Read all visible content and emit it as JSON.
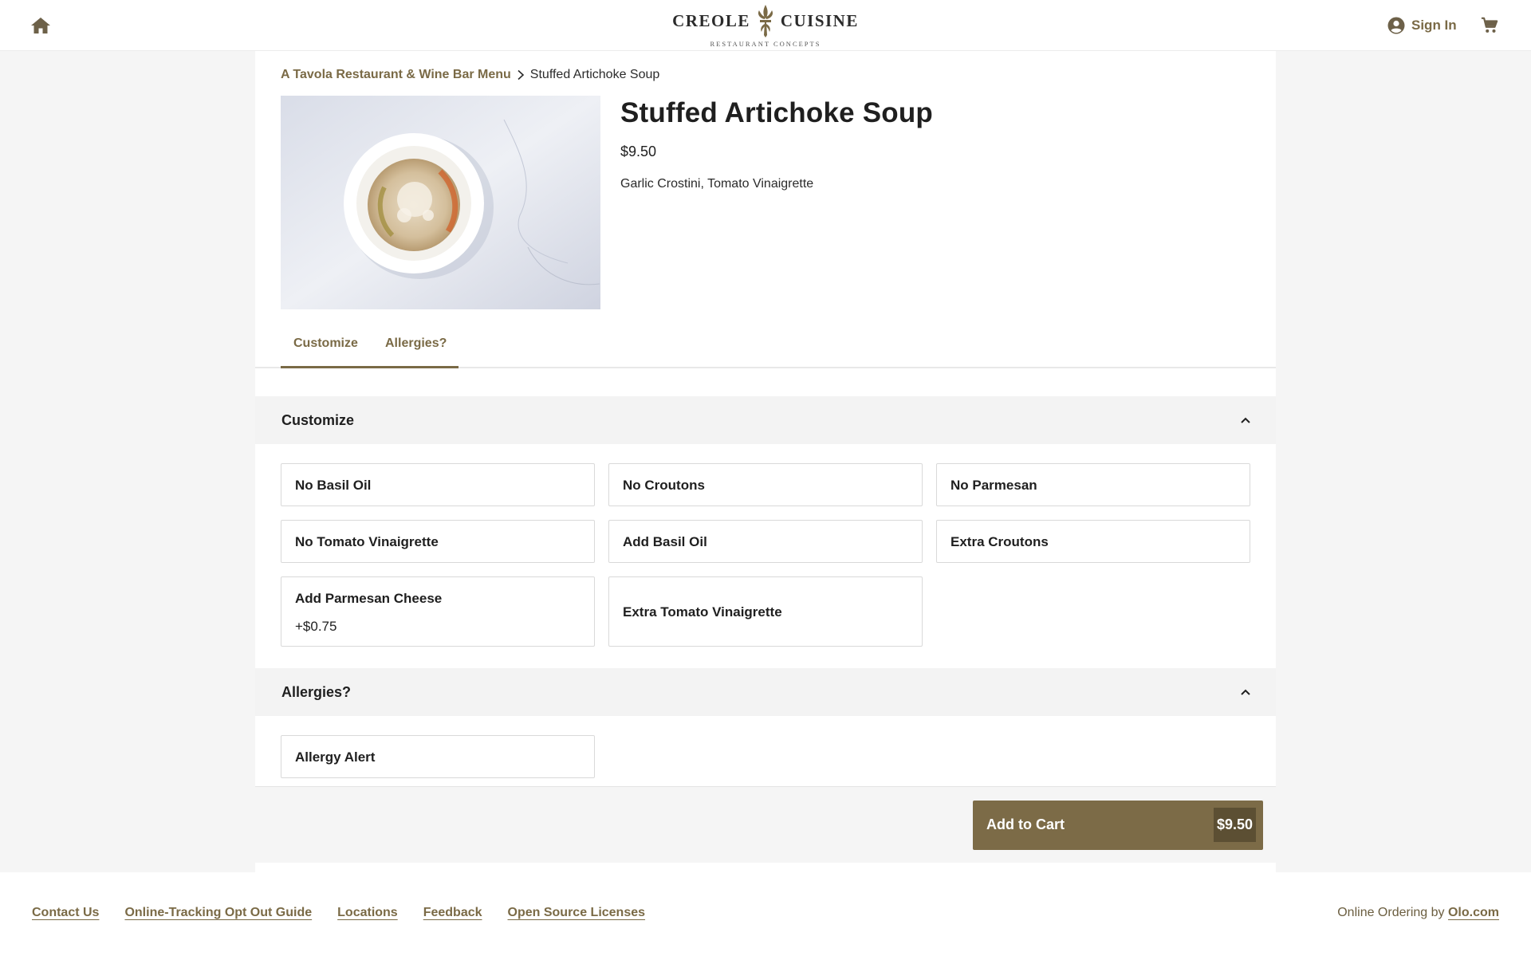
{
  "header": {
    "logo": {
      "left_word": "CREOLE",
      "right_word": "CUISINE",
      "subtitle": "RESTAURANT CONCEPTS"
    },
    "sign_in_label": "Sign In",
    "icons": {
      "home": "home-icon",
      "account": "account-circle-icon",
      "cart": "cart-icon"
    }
  },
  "breadcrumb": {
    "parent": "A Tavola Restaurant & Wine Bar Menu",
    "current": "Stuffed Artichoke Soup"
  },
  "product": {
    "title": "Stuffed Artichoke Soup",
    "price": "$9.50",
    "description": "Garlic Crostini, Tomato Vinaigrette"
  },
  "tabs": [
    {
      "label": "Customize"
    },
    {
      "label": "Allergies?"
    }
  ],
  "sections": {
    "customize": {
      "title": "Customize",
      "options": [
        {
          "label": "No Basil Oil"
        },
        {
          "label": "No Croutons"
        },
        {
          "label": "No Parmesan"
        },
        {
          "label": "No Tomato Vinaigrette"
        },
        {
          "label": "Add Basil Oil"
        },
        {
          "label": "Extra Croutons"
        },
        {
          "label": "Add Parmesan Cheese",
          "price": "+$0.75"
        },
        {
          "label": "Extra Tomato Vinaigrette"
        }
      ]
    },
    "allergies": {
      "title": "Allergies?",
      "options": [
        {
          "label": "Allergy Alert"
        }
      ]
    }
  },
  "cart_bar": {
    "button_label": "Add to Cart",
    "total": "$9.50"
  },
  "footer": {
    "links": [
      "Contact Us",
      "Online-Tracking Opt Out Guide",
      "Locations",
      "Feedback",
      "Open Source Licenses"
    ],
    "powered_prefix": "Online Ordering by",
    "powered_link": "Olo.com"
  },
  "colors": {
    "accent": "#7a6a46",
    "button": "#7c6b47",
    "button_price_bg": "#5c4f33",
    "section_bg": "#f3f3f3",
    "page_bg": "#f5f5f5"
  }
}
